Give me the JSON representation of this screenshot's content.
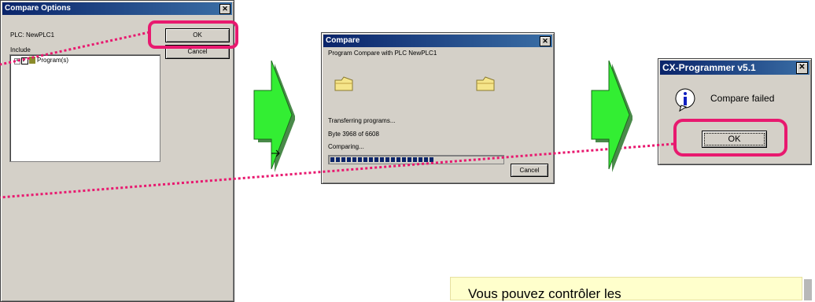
{
  "compare_options": {
    "title": "Compare Options",
    "plc_label": "PLC:",
    "plc_name": "NewPLC1",
    "include_label": "Include",
    "tree_item": "Program(s)",
    "ok_label": "OK",
    "cancel_label": "Cancel",
    "close_glyph": "✕"
  },
  "compare": {
    "title": "Compare",
    "heading": "Program Compare with PLC NewPLC1",
    "status_transferring": "Transferring programs...",
    "status_bytes": "Byte 3968 of 6608",
    "status_comparing": "Comparing...",
    "progress": 0.6,
    "cancel_label": "Cancel",
    "close_glyph": "✕"
  },
  "cx_dialog": {
    "title": "CX-Programmer v5.1",
    "message": "Compare failed",
    "ok_label": "OK",
    "close_glyph": "✕"
  },
  "note": {
    "text": "Vous pouvez contrôler les"
  },
  "colors": {
    "highlight": "#e8196f",
    "arrow": "#33ee33",
    "titlebar": "#0a246a"
  }
}
